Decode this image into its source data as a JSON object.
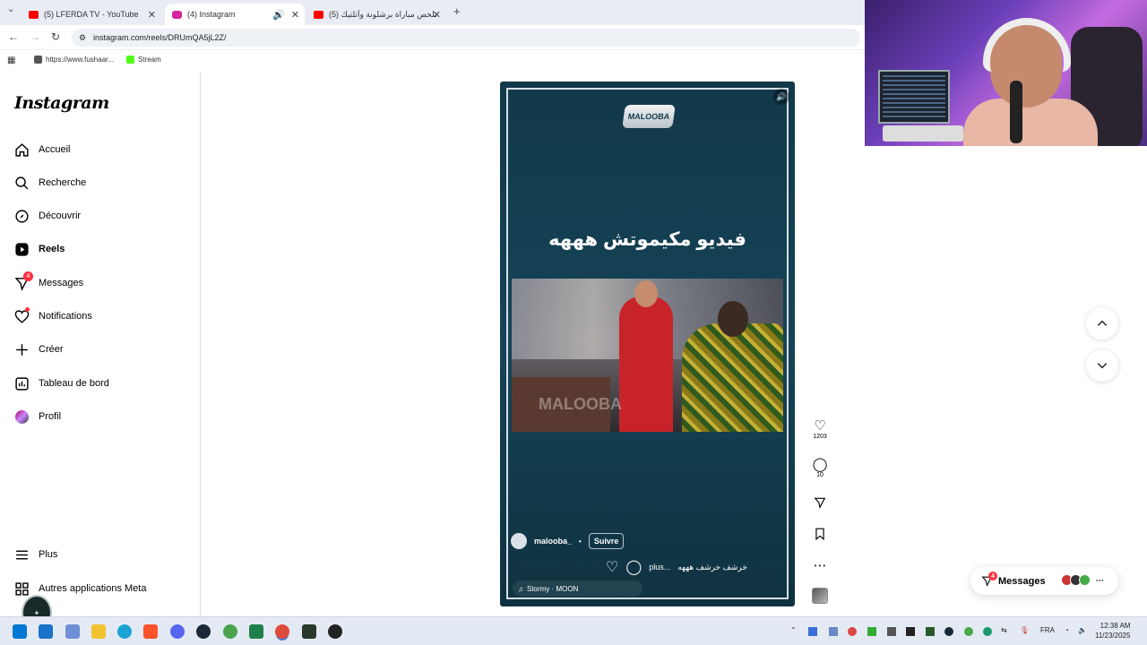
{
  "browser": {
    "tabs": [
      {
        "title": "(5) LFERDA TV - YouTube",
        "color": "#ff0000"
      },
      {
        "title": "(4) Instagram",
        "color": "#d6249f"
      },
      {
        "title": "(5) ملخص مباراة برشلونة وأتلتيك...",
        "color": "#ff0000"
      }
    ],
    "url": "instagram.com/reels/DRUmQA5jL2Z/",
    "bookmarks": [
      "https://www.fushaar...",
      "Stream"
    ]
  },
  "sidebar": {
    "logo": "Instagram",
    "items": [
      {
        "label": "Accueil",
        "icon": "home-icon"
      },
      {
        "label": "Recherche",
        "icon": "search-icon"
      },
      {
        "label": "Découvrir",
        "icon": "compass-icon"
      },
      {
        "label": "Reels",
        "icon": "reels-icon"
      },
      {
        "label": "Messages",
        "icon": "send-icon",
        "badge": "4"
      },
      {
        "label": "Notifications",
        "icon": "heart-icon"
      },
      {
        "label": "Créer",
        "icon": "plus-icon"
      },
      {
        "label": "Tableau de bord",
        "icon": "dashboard-icon"
      },
      {
        "label": "Profil",
        "icon": "avatar-icon"
      }
    ],
    "more": "Plus",
    "meta": "Autres applications Meta"
  },
  "reel": {
    "brand": "MALOOBA",
    "title": "فيديو مكيموتش هههه",
    "username": "malooba_",
    "follow": "Suivre",
    "caption": "خرشف خرشف هههه",
    "more": "plus...",
    "audio": "Stormy · MOON",
    "watermark": "MALOOBA"
  },
  "actions": {
    "likes": "1203",
    "comments": "10"
  },
  "messages_pill": {
    "label": "Messages",
    "badge": "4"
  },
  "taskbar": {
    "lang": "FRA",
    "time": "12:38 AM",
    "date": "11/23/2025"
  },
  "colors": {
    "reel_bg": "#164357",
    "badge": "#ff3040",
    "taskbar": "#e4eaf4"
  }
}
